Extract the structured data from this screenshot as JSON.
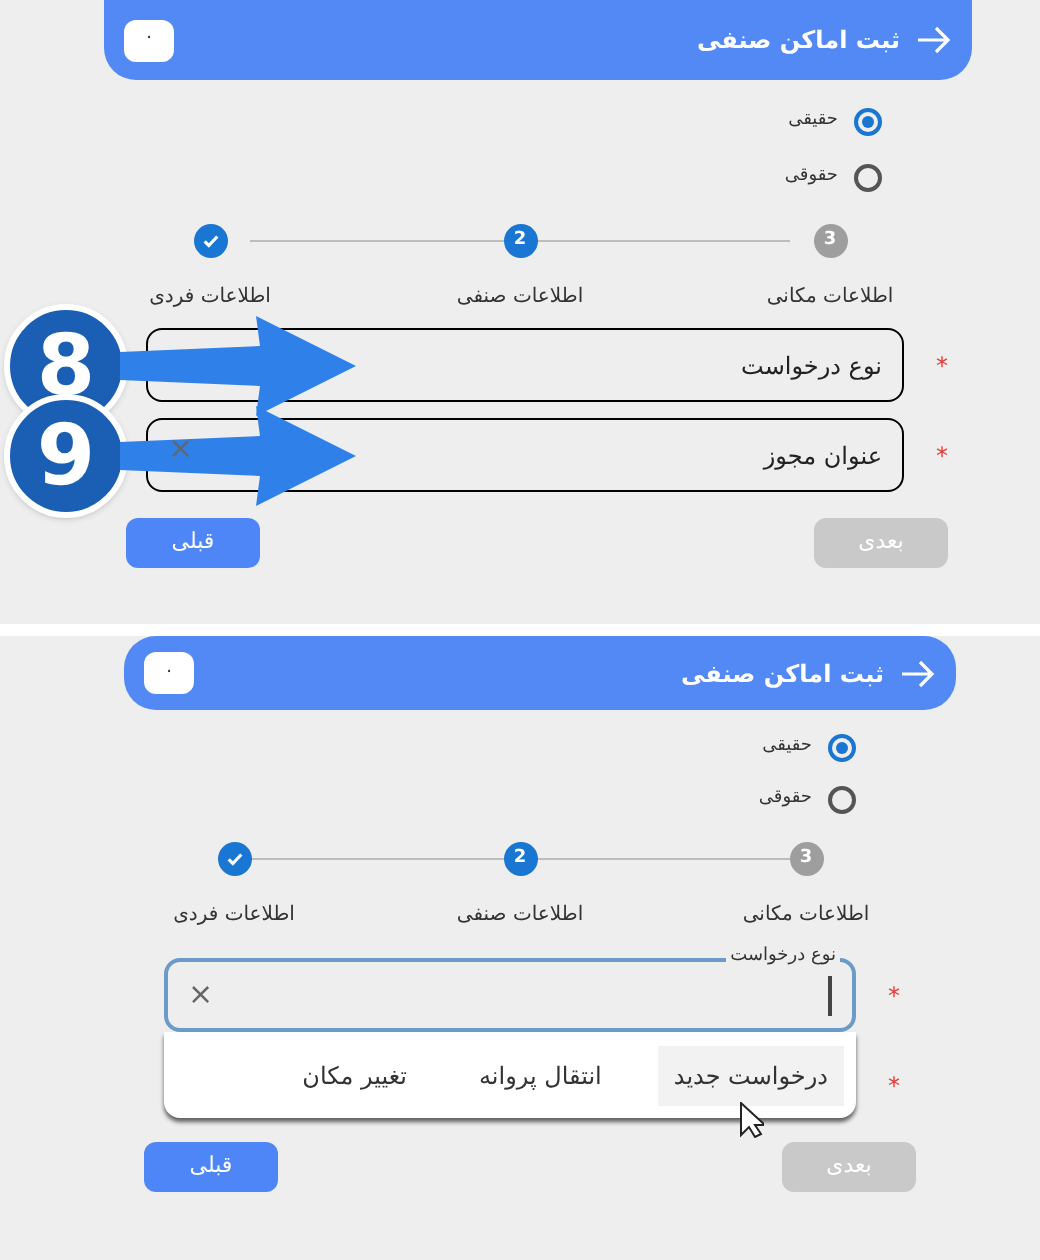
{
  "panels": [
    {
      "header": {
        "title": "ثبت اماکن صنفی",
        "badge": "٠"
      },
      "radios": [
        {
          "label": "حقیقی",
          "selected": true
        },
        {
          "label": "حقوقی",
          "selected": false
        }
      ],
      "steps": [
        {
          "label": "اطلاعات مکانی",
          "number": "3",
          "kind": "pending"
        },
        {
          "label": "اطلاعات صنفی",
          "number": "2",
          "kind": "current"
        },
        {
          "label": "اطلاعات فردی",
          "kind": "done"
        }
      ],
      "fields": [
        {
          "label": "نوع درخواست",
          "asterisk": "*",
          "callout": "8"
        },
        {
          "label": "عنوان مجوز",
          "asterisk": "*",
          "clear": "×",
          "callout": "9"
        }
      ],
      "buttons": [
        {
          "label": "بعدی",
          "disabled": true
        },
        {
          "label": "قبلی",
          "disabled": false
        }
      ]
    },
    {
      "header": {
        "title": "ثبت اماکن صنفی",
        "badge": "٠"
      },
      "radios": [
        {
          "label": "حقیقی",
          "selected": true
        },
        {
          "label": "حقوقی",
          "selected": false
        }
      ],
      "steps": [
        {
          "label": "اطلاعات مکانی",
          "number": "3",
          "kind": "pending"
        },
        {
          "label": "اطلاعات صنفی",
          "number": "2",
          "kind": "current"
        },
        {
          "label": "اطلاعات فردی",
          "kind": "done"
        }
      ],
      "fields": [
        {
          "label": "نوع درخواست",
          "asterisk": "*",
          "clear": "×",
          "focused": true,
          "options": [
            {
              "label": "درخواست جدید",
              "selected": true
            },
            {
              "label": "انتقال پروانه",
              "selected": false
            },
            {
              "label": "تغییر مکان",
              "selected": false
            }
          ]
        },
        {
          "asterisk": "*"
        }
      ],
      "buttons": [
        {
          "label": "بعدی",
          "disabled": true
        },
        {
          "label": "قبلی",
          "disabled": false
        }
      ]
    }
  ]
}
